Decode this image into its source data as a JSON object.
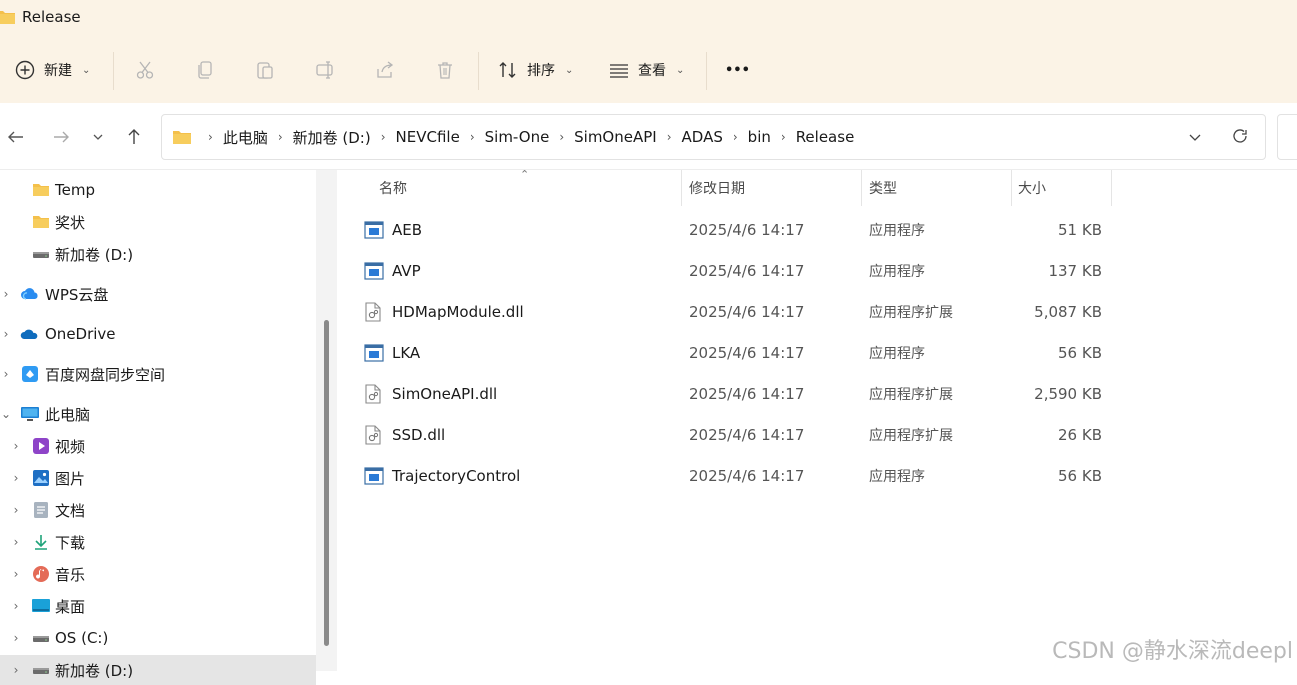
{
  "window": {
    "title": "Release"
  },
  "toolbar": {
    "new_label": "新建",
    "sort_label": "排序",
    "view_label": "查看",
    "more_label": "•••"
  },
  "address": {
    "crumbs": [
      "此电脑",
      "新加卷 (D:)",
      "NEVCfile",
      "Sim-One",
      "SimOneAPI",
      "ADAS",
      "bin",
      "Release"
    ]
  },
  "sidebar": {
    "items": [
      {
        "label": "Temp",
        "icon": "folder-icon"
      },
      {
        "label": "奖状",
        "icon": "folder-icon"
      },
      {
        "label": "新加卷 (D:)",
        "icon": "drive-icon"
      },
      {
        "label": "WPS云盘",
        "icon": "cloud-icon"
      },
      {
        "label": "OneDrive",
        "icon": "onedrive-icon"
      },
      {
        "label": "百度网盘同步空间",
        "icon": "baidu-icon"
      },
      {
        "label": "此电脑",
        "icon": "pc-icon"
      },
      {
        "label": "视频",
        "icon": "video-icon"
      },
      {
        "label": "图片",
        "icon": "picture-icon"
      },
      {
        "label": "文档",
        "icon": "document-icon"
      },
      {
        "label": "下载",
        "icon": "download-icon"
      },
      {
        "label": "音乐",
        "icon": "music-icon"
      },
      {
        "label": "桌面",
        "icon": "desktop-icon"
      },
      {
        "label": "OS (C:)",
        "icon": "drive-icon"
      },
      {
        "label": "新加卷 (D:)",
        "icon": "drive-icon"
      }
    ]
  },
  "columns": {
    "name": "名称",
    "date": "修改日期",
    "type": "类型",
    "size": "大小"
  },
  "files": [
    {
      "name": "AEB",
      "date": "2025/4/6 14:17",
      "type": "应用程序",
      "size": "51 KB",
      "icon": "app-icon"
    },
    {
      "name": "AVP",
      "date": "2025/4/6 14:17",
      "type": "应用程序",
      "size": "137 KB",
      "icon": "app-icon"
    },
    {
      "name": "HDMapModule.dll",
      "date": "2025/4/6 14:17",
      "type": "应用程序扩展",
      "size": "5,087 KB",
      "icon": "dll-icon"
    },
    {
      "name": "LKA",
      "date": "2025/4/6 14:17",
      "type": "应用程序",
      "size": "56 KB",
      "icon": "app-icon"
    },
    {
      "name": "SimOneAPI.dll",
      "date": "2025/4/6 14:17",
      "type": "应用程序扩展",
      "size": "2,590 KB",
      "icon": "dll-icon"
    },
    {
      "name": "SSD.dll",
      "date": "2025/4/6 14:17",
      "type": "应用程序扩展",
      "size": "26 KB",
      "icon": "dll-icon"
    },
    {
      "name": "TrajectoryControl",
      "date": "2025/4/6 14:17",
      "type": "应用程序",
      "size": "56 KB",
      "icon": "app-icon"
    }
  ],
  "watermark": "CSDN @静水深流deepl",
  "colors": {
    "toolbar_bg": "#fbf3e6",
    "folder": "#f4c04b",
    "selection": "#e5e5e5"
  }
}
